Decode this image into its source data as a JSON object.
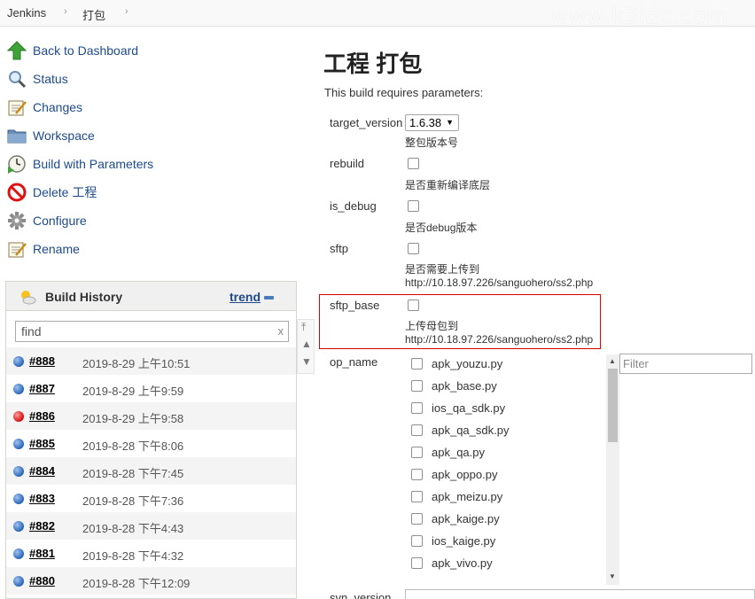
{
  "breadcrumb": {
    "root": "Jenkins",
    "job": "打包",
    "sep": "›"
  },
  "watermark": "www.k3idc.com",
  "sidebar": {
    "items": [
      {
        "label": "Back to Dashboard",
        "icon": "up-arrow-icon"
      },
      {
        "label": "Status",
        "icon": "magnifier-icon"
      },
      {
        "label": "Changes",
        "icon": "notepad-icon"
      },
      {
        "label": "Workspace",
        "icon": "folder-icon"
      },
      {
        "label": "Build with Parameters",
        "icon": "clock-play-icon"
      },
      {
        "label": "Delete 工程",
        "icon": "no-entry-icon"
      },
      {
        "label": "Configure",
        "icon": "gear-icon"
      },
      {
        "label": "Rename",
        "icon": "notepad-icon"
      }
    ]
  },
  "build_history": {
    "title": "Build History",
    "trend": "trend",
    "find_placeholder": "find",
    "clear": "x",
    "builds": [
      {
        "num": "#888",
        "date": "2019-8-29 上午10:51",
        "status": "blue"
      },
      {
        "num": "#887",
        "date": "2019-8-29 上午9:59",
        "status": "blue"
      },
      {
        "num": "#886",
        "date": "2019-8-29 上午9:58",
        "status": "red"
      },
      {
        "num": "#885",
        "date": "2019-8-28 下午8:06",
        "status": "blue"
      },
      {
        "num": "#884",
        "date": "2019-8-28 下午7:45",
        "status": "blue"
      },
      {
        "num": "#883",
        "date": "2019-8-28 下午7:36",
        "status": "blue"
      },
      {
        "num": "#882",
        "date": "2019-8-28 下午4:43",
        "status": "blue"
      },
      {
        "num": "#881",
        "date": "2019-8-28 下午4:32",
        "status": "blue"
      },
      {
        "num": "#880",
        "date": "2019-8-28 下午12:09",
        "status": "blue"
      }
    ]
  },
  "main": {
    "title": "工程 打包",
    "requires": "This build requires parameters:",
    "target_version": {
      "name": "target_version",
      "value": "1.6.38",
      "desc": "整包版本号"
    },
    "rebuild": {
      "name": "rebuild",
      "desc": "是否重新编译底层"
    },
    "is_debug": {
      "name": "is_debug",
      "desc": "是否debug版本"
    },
    "sftp": {
      "name": "sftp",
      "desc1": "是否需要上传到",
      "desc2": "http://10.18.97.226/sanguohero/ss2.php"
    },
    "sftp_base": {
      "name": "sftp_base",
      "desc1": "上传母包到",
      "desc2": "http://10.18.97.226/sanguohero/ss2.php"
    },
    "op_name": {
      "name": "op_name",
      "filter_placeholder": "Filter",
      "options": [
        "apk_youzu.py",
        "apk_base.py",
        "ios_qa_sdk.py",
        "apk_qa_sdk.py",
        "apk_qa.py",
        "apk_oppo.py",
        "apk_meizu.py",
        "apk_kaige.py",
        "ios_kaige.py",
        "apk_vivo.py"
      ]
    },
    "svn_version": {
      "name": "svn_version"
    }
  }
}
